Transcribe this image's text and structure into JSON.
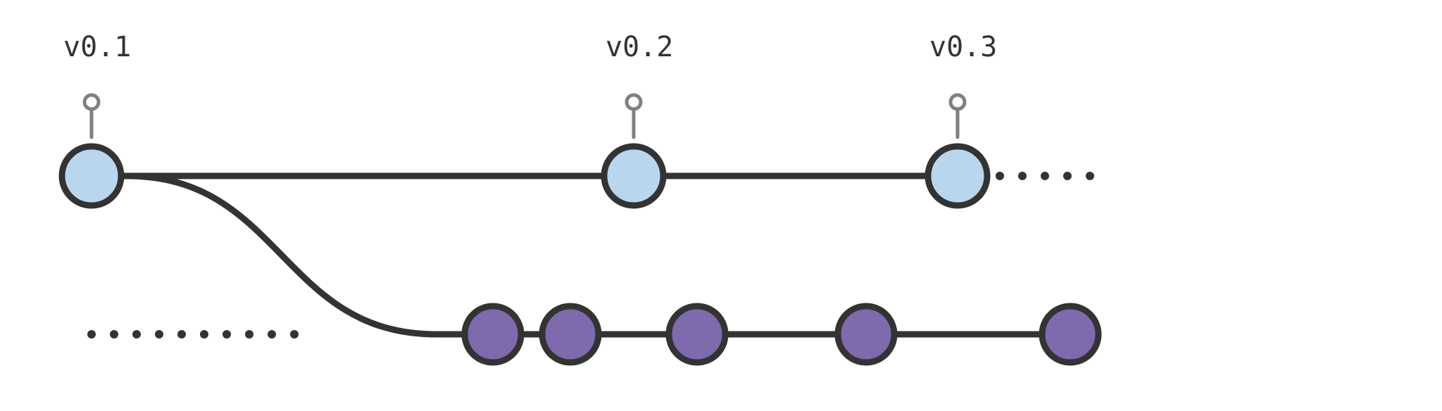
{
  "diagram": {
    "description": "Git-style branch diagram with tags",
    "tags": [
      {
        "id": "tag0",
        "label": "v0.1"
      },
      {
        "id": "tag1",
        "label": "v0.2"
      },
      {
        "id": "tag2",
        "label": "v0.3"
      }
    ],
    "branches": {
      "main": {
        "color": "#bad6ef",
        "commits": 3,
        "trailing": "continues"
      },
      "feature": {
        "color": "#7e6aad",
        "commits": 5,
        "leading": "continues",
        "branched_from": "main"
      }
    },
    "colors": {
      "main_node_fill": "#bad6ef",
      "feature_node_fill": "#7e6aad",
      "stroke": "#333333",
      "tag_text": "#333333",
      "tag_line": "#808080"
    }
  }
}
